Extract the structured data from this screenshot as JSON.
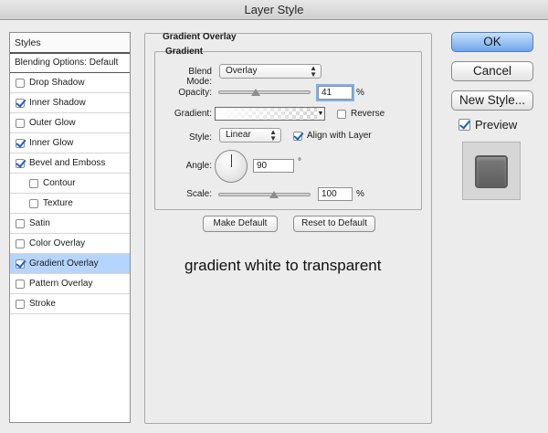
{
  "window": {
    "title": "Layer Style"
  },
  "styles_panel": {
    "header": "Styles",
    "blending": "Blending Options: Default",
    "items": [
      {
        "label": "Drop Shadow",
        "checked": false,
        "sub": false
      },
      {
        "label": "Inner Shadow",
        "checked": true,
        "sub": false
      },
      {
        "label": "Outer Glow",
        "checked": false,
        "sub": false
      },
      {
        "label": "Inner Glow",
        "checked": true,
        "sub": false
      },
      {
        "label": "Bevel and Emboss",
        "checked": true,
        "sub": false
      },
      {
        "label": "Contour",
        "checked": false,
        "sub": true
      },
      {
        "label": "Texture",
        "checked": false,
        "sub": true
      },
      {
        "label": "Satin",
        "checked": false,
        "sub": false
      },
      {
        "label": "Color Overlay",
        "checked": false,
        "sub": false
      },
      {
        "label": "Gradient Overlay",
        "checked": true,
        "sub": false,
        "selected": true
      },
      {
        "label": "Pattern Overlay",
        "checked": false,
        "sub": false
      },
      {
        "label": "Stroke",
        "checked": false,
        "sub": false
      }
    ]
  },
  "gradient_overlay": {
    "group_title": "Gradient Overlay",
    "section_title": "Gradient",
    "blend_mode_label": "Blend Mode:",
    "blend_mode_value": "Overlay",
    "opacity_label": "Opacity:",
    "opacity_value": "41",
    "opacity_unit": "%",
    "gradient_label": "Gradient:",
    "reverse_label": "Reverse",
    "reverse_checked": false,
    "style_label": "Style:",
    "style_value": "Linear",
    "align_label": "Align with Layer",
    "align_checked": true,
    "angle_label": "Angle:",
    "angle_value": "90",
    "angle_unit": "°",
    "scale_label": "Scale:",
    "scale_value": "100",
    "scale_unit": "%",
    "make_default_label": "Make Default",
    "reset_default_label": "Reset to Default"
  },
  "note": "gradient white to transparent",
  "buttons": {
    "ok": "OK",
    "cancel": "Cancel",
    "new_style": "New Style..."
  },
  "preview": {
    "label": "Preview",
    "checked": true
  },
  "colors": {
    "accent": "#6fa6ea",
    "selection": "#b5d5ff",
    "checkmark": "#1a5fc9"
  }
}
